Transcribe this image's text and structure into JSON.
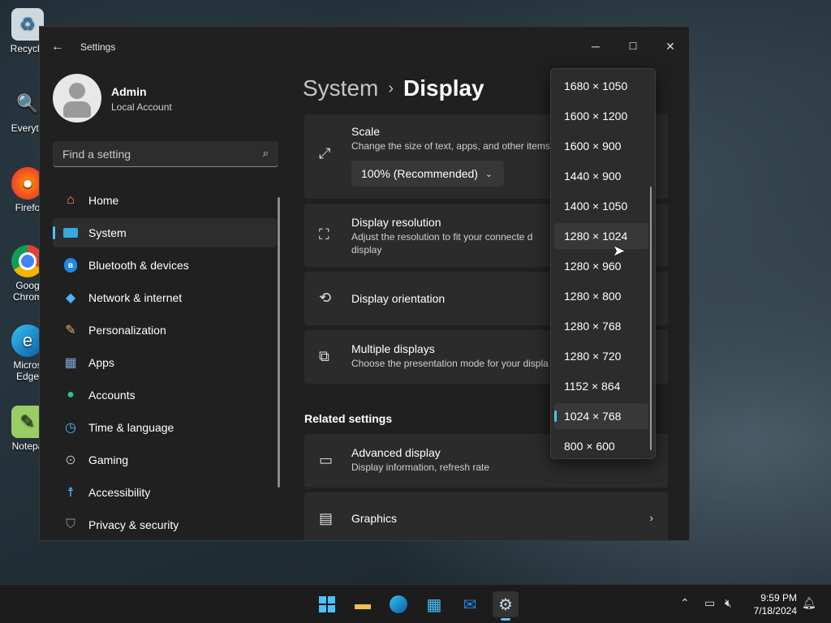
{
  "desktop": {
    "icons": [
      {
        "label": "Recycle",
        "icon": "recycle-bin-icon"
      },
      {
        "label": "Everyth",
        "icon": "everything-search-icon"
      },
      {
        "label": "Firefo",
        "icon": "firefox-icon"
      },
      {
        "label": "Goog Chrom",
        "icon": "chrome-icon"
      },
      {
        "label": "Micros Edge",
        "icon": "edge-icon"
      },
      {
        "label": "Notepa",
        "icon": "notepad-icon"
      }
    ]
  },
  "window": {
    "title": "Settings",
    "controls": {
      "minimize": "─",
      "maximize": "☐",
      "close": "✕"
    }
  },
  "profile": {
    "name": "Admin",
    "account_type": "Local Account"
  },
  "search": {
    "placeholder": "Find a setting",
    "value": ""
  },
  "nav": {
    "items": [
      {
        "label": "Home",
        "icon": "home-icon"
      },
      {
        "label": "System",
        "icon": "system-icon",
        "selected": true
      },
      {
        "label": "Bluetooth & devices",
        "icon": "bluetooth-icon"
      },
      {
        "label": "Network & internet",
        "icon": "wifi-icon"
      },
      {
        "label": "Personalization",
        "icon": "brush-icon"
      },
      {
        "label": "Apps",
        "icon": "apps-icon"
      },
      {
        "label": "Accounts",
        "icon": "person-icon"
      },
      {
        "label": "Time & language",
        "icon": "clock-globe-icon"
      },
      {
        "label": "Gaming",
        "icon": "gamepad-icon"
      },
      {
        "label": "Accessibility",
        "icon": "accessibility-icon"
      },
      {
        "label": "Privacy & security",
        "icon": "shield-icon"
      }
    ]
  },
  "breadcrumb": {
    "parent": "System",
    "current": "Display",
    "separator": "›"
  },
  "cards": {
    "scale": {
      "title": "Scale",
      "subtitle": "Change the size of text, apps, and other items",
      "value": "100% (Recommended)"
    },
    "resolution": {
      "title": "Display resolution",
      "subtitle": "Adjust the resolution to fit your connecte d display"
    },
    "orientation": {
      "title": "Display orientation"
    },
    "multiple": {
      "title": "Multiple displays",
      "subtitle": "Choose the presentation mode for your displa"
    }
  },
  "related": {
    "heading": "Related settings",
    "advanced": {
      "title": "Advanced display",
      "subtitle": "Display information, refresh rate"
    },
    "graphics": {
      "title": "Graphics"
    }
  },
  "resolution_options": [
    "1680 × 1050",
    "1600 × 1200",
    "1600 × 900",
    "1440 × 900",
    "1400 × 1050",
    "1280 × 1024",
    "1280 × 960",
    "1280 × 800",
    "1280 × 768",
    "1280 × 720",
    "1152 × 864",
    "1024 × 768",
    "800 × 600"
  ],
  "resolution_hovered": "1280 × 1024",
  "resolution_selected": "1024 × 768",
  "taskbar": {
    "apps": [
      "start-icon",
      "file-explorer-icon",
      "edge-icon",
      "store-icon",
      "outlook-icon",
      "settings-icon"
    ],
    "clock_time": "9:59 PM",
    "clock_date": "7/18/2024"
  },
  "colors": {
    "accent": "#4cc2ff",
    "window_bg": "#202020",
    "card_bg": "#2b2b2b"
  }
}
